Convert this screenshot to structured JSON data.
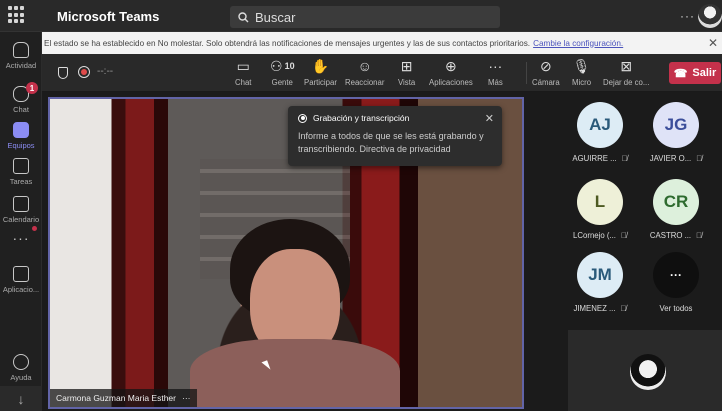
{
  "titlebar": {
    "app_title": "Microsoft Teams",
    "search_placeholder": "Buscar",
    "more": "···"
  },
  "rail": {
    "items": [
      {
        "label": "Actividad"
      },
      {
        "label": "Chat",
        "badge": "1"
      },
      {
        "label": "Equipos"
      },
      {
        "label": "Tareas"
      },
      {
        "label": "Calendario"
      },
      {
        "label": "···"
      },
      {
        "label": "Aplicacio..."
      },
      {
        "label": "Ayuda"
      }
    ]
  },
  "banner": {
    "text": "El estado se ha establecido en No molestar. Solo obtendrá las notificaciones de mensajes urgentes y las de sus contactos prioritarios.",
    "link": "Cambie la configuración."
  },
  "meeting": {
    "timer": "--:--",
    "buttons": {
      "chat": "Chat",
      "people": "Gente",
      "people_count": "10",
      "participate": "Participar",
      "react": "Reaccionar",
      "view": "Vista",
      "apps": "Aplicaciones",
      "more": "Más",
      "camera": "Cámara",
      "mic": "Micro",
      "share": "Dejar de co...",
      "leave": "Salir"
    },
    "main_participant": "Carmona Guzman Maria Esther",
    "main_more": "···",
    "popup": {
      "title": "Grabación y transcripción",
      "text": "Informe a todos de que se les está grabando y transcribiendo. Directiva de privacidad"
    },
    "participants": [
      {
        "initials": "AJ",
        "name": "AGUIRRE ...",
        "bg": "#ddecf5",
        "fg": "#2a5a7a"
      },
      {
        "initials": "JG",
        "name": "JAVIER O...",
        "bg": "#dfe3f7",
        "fg": "#3b4e9a"
      },
      {
        "initials": "L",
        "name": "LCornejo (...",
        "bg": "#eef0d8",
        "fg": "#4d5a22"
      },
      {
        "initials": "CR",
        "name": "CASTRO ...",
        "bg": "#ddf0dc",
        "fg": "#2e6b2f"
      },
      {
        "initials": "JM",
        "name": "JIMENEZ ...",
        "bg": "#ddecf5",
        "fg": "#2a5a7a"
      },
      {
        "initials": "···",
        "name": "Ver todos",
        "bg": "#0f0f0f",
        "fg": "#ffffff"
      }
    ]
  }
}
